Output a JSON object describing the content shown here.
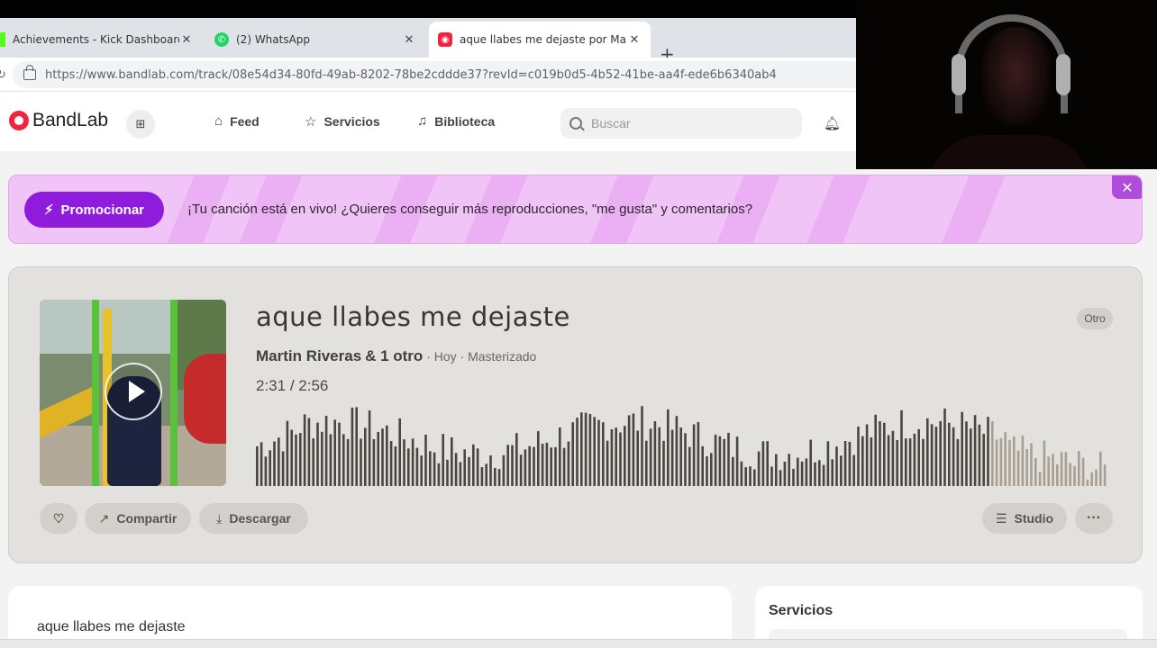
{
  "browser": {
    "tabs": [
      {
        "label": "Achievements - Kick Dashboard",
        "close": "✕"
      },
      {
        "label": "(2) WhatsApp",
        "close": "✕"
      },
      {
        "label": "aque llabes me dejaste por Martin",
        "close": "✕"
      }
    ],
    "new_tab": "+",
    "url": "https://www.bandlab.com/track/08e54d34-80fd-49ab-8202-78be2cddde37?revId=c019b0d5-4b52-41be-aa4f-ede6b6340ab4"
  },
  "header": {
    "brand": "BandLab",
    "nav": [
      {
        "label": "Feed",
        "icon": "home-icon"
      },
      {
        "label": "Servicios",
        "icon": "star-icon"
      },
      {
        "label": "Biblioteca",
        "icon": "library-icon"
      }
    ],
    "search_placeholder": "Buscar"
  },
  "promo": {
    "button": "Promocionar",
    "text": "¡Tu canción está en vivo! ¿Quieres conseguir más reproducciones, \"me gusta\" y comentarios?",
    "close": "✕"
  },
  "track": {
    "title": "aque llabes me dejaste",
    "artist": "Martin Riveras",
    "others": "& 1 otro",
    "meta": "· Hoy · Masterizado",
    "current_time": "2:31",
    "separator": "/",
    "total_time": "2:56",
    "genre": "Otro",
    "progress": 0.858,
    "played_color": "#4a4540",
    "unplayed_color": "#a89e92",
    "actions": {
      "share": "Compartir",
      "download": "Descargar",
      "studio": "Studio",
      "more": "···"
    }
  },
  "description": {
    "title": "aque llabes me dejaste"
  },
  "services": {
    "title": "Servicios"
  }
}
